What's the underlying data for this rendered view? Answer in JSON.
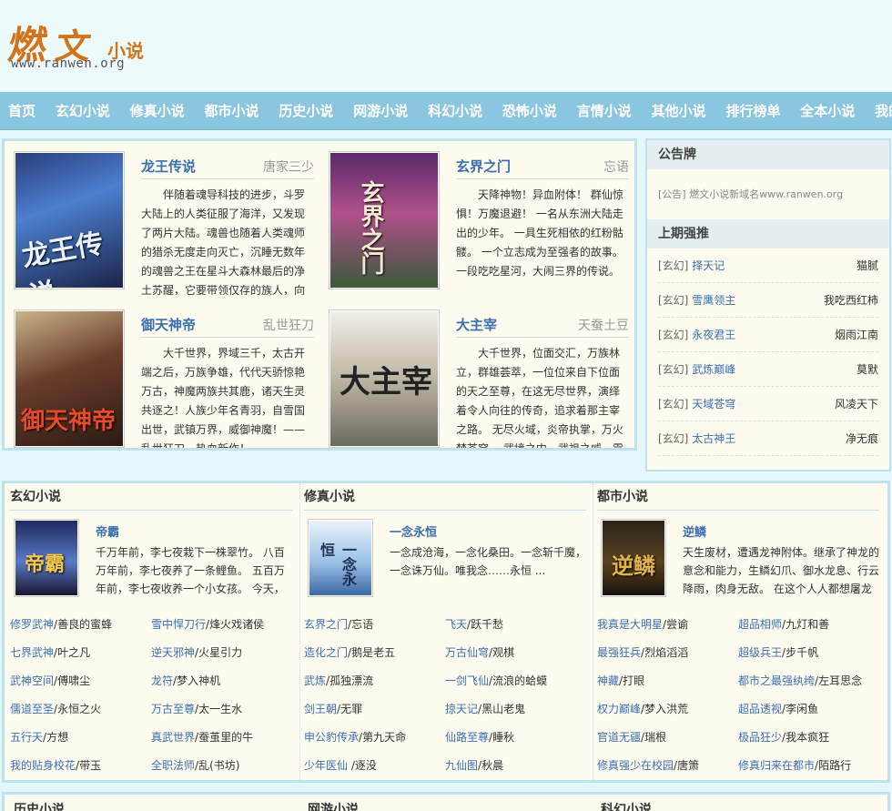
{
  "site": {
    "logo_glyph1": "燃",
    "logo_glyph2": "文",
    "logo_glyph3": "小说",
    "logo_domain": "www.ranwen.org"
  },
  "nav": [
    "首页",
    "玄幻小说",
    "修真小说",
    "都市小说",
    "历史小说",
    "网游小说",
    "科幻小说",
    "恐怖小说",
    "言情小说",
    "其他小说",
    "排行榜单",
    "全本小说",
    "我的"
  ],
  "featured": [
    {
      "title": "龙王传说",
      "author": "唐家三少",
      "cover_text": "龙王传说",
      "desc": "伴随着魂导科技的进步，斗罗大陆上的人类征服了海洋，又发现了两片大陆。魂兽也随着人类魂师的猎杀无度走向灭亡，沉睡无数年的魂兽之王在星斗大森林最后的净土苏醒，它要带领仅存的族人，向"
    },
    {
      "title": "玄界之门",
      "author": "忘语",
      "cover_text": "玄界之门",
      "desc": "天降神物！异血附体！ 群仙惊惧！万魔退避！ 一名从东洲大陆走出的少年。 一具生死相依的红粉骷髅。 一个立志成为至强者的故事。一段吃吃星河，大闹三界的传说。"
    },
    {
      "title": "御天神帝",
      "author": "乱世狂刀",
      "cover_text": "御天神帝",
      "desc": "大千世界，界域三千，太古开端之后，万族争雄，代代天骄惊艳万古，神魔两族共其鹿，诸天生灵共逐之！人族少年名青羽，自雪国出世，武镇万界，威御神魔！——乱世狂刀，热血新作！"
    },
    {
      "title": "大主宰",
      "author": "天蚕土豆",
      "cover_text": "大主宰",
      "desc": "大千世界，位面交汇，万族林立，群雄荟萃，一位位来自下位面的天之至尊，在这无尽世界，演绎着令人向往的传奇，追求着那主宰之路。 无尽火域，炎帝执掌，万火焚苍穹。 武境之内，武祖之威，震"
    }
  ],
  "sidebar": {
    "notice_title": "公告牌",
    "notice_tag": "[公告]",
    "notice_text": "燃文小说新域名www.ranwen.org",
    "rank_title": "上期强推",
    "rank": [
      {
        "cat": "[玄幻]",
        "book": "择天记",
        "author": "猫腻"
      },
      {
        "cat": "[玄幻]",
        "book": "雪鹰领主",
        "author": "我吃西红柿"
      },
      {
        "cat": "[玄幻]",
        "book": "永夜君王",
        "author": "烟雨江南"
      },
      {
        "cat": "[玄幻]",
        "book": "武炼巅峰",
        "author": "莫默"
      },
      {
        "cat": "[玄幻]",
        "book": "天域苍穹",
        "author": "风凌天下"
      },
      {
        "cat": "[玄幻]",
        "book": "太古神王",
        "author": "净无痕"
      }
    ]
  },
  "categories": [
    {
      "name": "玄幻小说",
      "book": "帝霸",
      "cover_text": "帝霸",
      "desc": "千万年前，李七夜栽下一株翠竹。 八百万年前，李七夜养了一条鲤鱼。 五百万年前，李七夜收养一个小女孩。 今天，",
      "list": [
        [
          {
            "b": "修罗武神",
            "a": "善良的蜜蜂"
          },
          {
            "b": "雪中悍刀行",
            "a": "烽火戏诸侯"
          }
        ],
        [
          {
            "b": "七界武神",
            "a": "叶之凡"
          },
          {
            "b": "逆天邪神",
            "a": "火星引力"
          }
        ],
        [
          {
            "b": "武神空间",
            "a": "傅啸尘"
          },
          {
            "b": "龙符",
            "a": "梦入神机"
          }
        ],
        [
          {
            "b": "儒道至圣",
            "a": "永恒之火"
          },
          {
            "b": "万古至尊",
            "a": "太一生水"
          }
        ],
        [
          {
            "b": "五行天",
            "a": "方想"
          },
          {
            "b": "真武世界",
            "a": "蚕茧里的牛"
          }
        ],
        [
          {
            "b": "我的贴身校花",
            "a": "带玉"
          },
          {
            "b": "全职法师",
            "a": "乱(书坊)"
          }
        ]
      ]
    },
    {
      "name": "修真小说",
      "book": "一念永恒",
      "cover_text": "一念永恒",
      "desc": "一念成沧海，一念化桑田。一念斩千魔，一念诛万仙。唯我念……永恒 ...",
      "list": [
        [
          {
            "b": "玄界之门",
            "a": "忘语"
          },
          {
            "b": "飞天",
            "a": "跃千愁"
          }
        ],
        [
          {
            "b": "造化之门",
            "a": "鹅是老五"
          },
          {
            "b": "万古仙穹",
            "a": "观棋"
          }
        ],
        [
          {
            "b": "武炼",
            "a": "孤独漂流"
          },
          {
            "b": "一剑飞仙",
            "a": "流浪的蛤蟆"
          }
        ],
        [
          {
            "b": "剑王朝",
            "a": "无罪"
          },
          {
            "b": "掠天记",
            "a": "黑山老鬼"
          }
        ],
        [
          {
            "b": "申公豹传承",
            "a": "第九天命"
          },
          {
            "b": "仙路至尊",
            "a": "睡秋"
          }
        ],
        [
          {
            "b": "少年医仙 ",
            "a": "逐没"
          },
          {
            "b": "九仙图",
            "a": "秋晨"
          }
        ]
      ]
    },
    {
      "name": "都市小说",
      "book": "逆鳞",
      "cover_text": "逆鳞",
      "desc": "天生废材，遭遇龙神附体。继承了神龙的意念和能力，生鳞幻爪、御水龙息、行云降雨，肉身无敌。 在这个人人都想屠龙",
      "list": [
        [
          {
            "b": "我真是大明星",
            "a": "尝谕"
          },
          {
            "b": "超品相师",
            "a": "九灯和善"
          }
        ],
        [
          {
            "b": "最强狂兵",
            "a": "烈焰滔滔"
          },
          {
            "b": "超级兵王",
            "a": "步千帆"
          }
        ],
        [
          {
            "b": "神藏",
            "a": "打眼"
          },
          {
            "b": "都市之最强纨绔",
            "a": "左耳思念"
          }
        ],
        [
          {
            "b": "权力巅峰",
            "a": "梦入洪荒"
          },
          {
            "b": "超品透视",
            "a": "李闲鱼"
          }
        ],
        [
          {
            "b": "官道无疆",
            "a": "瑞根"
          },
          {
            "b": "极品狂少",
            "a": "我本疯狂"
          }
        ],
        [
          {
            "b": "修真强少在校园",
            "a": "唐箫"
          },
          {
            "b": "修真归来在都市",
            "a": "陌路行"
          }
        ]
      ]
    }
  ],
  "bottom_heads": [
    "历史小说",
    "网游小说",
    "科幻小说"
  ]
}
